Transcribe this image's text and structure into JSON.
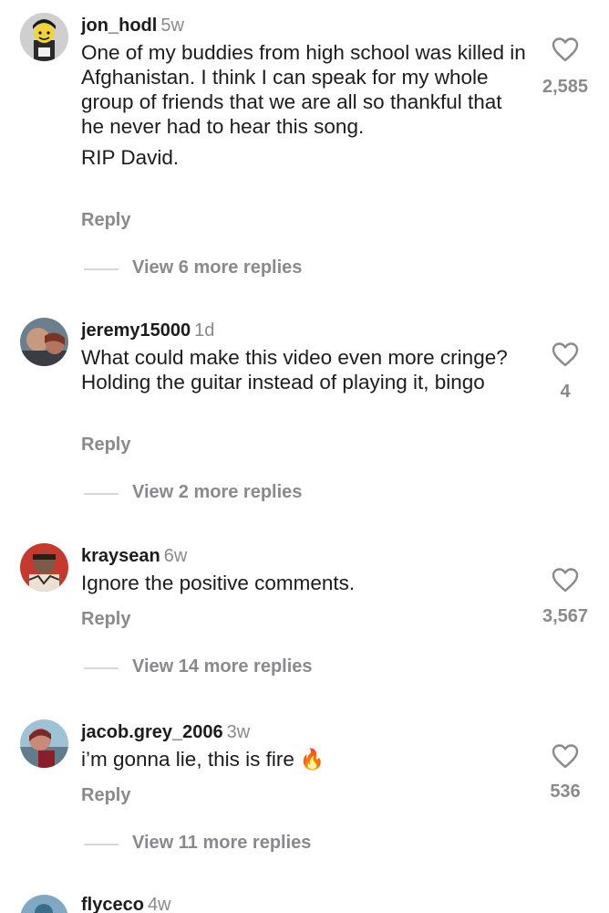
{
  "comments": [
    {
      "username": "jon_hodl",
      "time": "5w",
      "lines": [
        "One of my buddies from high school was killed in Afghanistan. I think I can speak for my whole group of friends that we are all so thankful that he never had to hear this song.",
        "RIP David."
      ],
      "reply_label": "Reply",
      "likes": "2,585",
      "view_more": "View 6 more replies"
    },
    {
      "username": "jeremy15000",
      "time": "1d",
      "lines": [
        "What could make this video even more cringe? Holding the guitar instead of playing it, bingo"
      ],
      "reply_label": "Reply",
      "likes": "4",
      "view_more": "View 2 more replies"
    },
    {
      "username": "kraysean",
      "time": "6w",
      "lines": [
        "Ignore the positive comments."
      ],
      "reply_label": "Reply",
      "likes": "3,567",
      "view_more": "View 14 more replies"
    },
    {
      "username": "jacob.grey_2006",
      "time": "3w",
      "lines": [
        "i’m gonna lie, this is fire"
      ],
      "emoji": "🔥",
      "reply_label": "Reply",
      "likes": "536",
      "view_more": "View 11 more replies"
    },
    {
      "username": "flyceco",
      "time": "4w"
    }
  ],
  "icons": {
    "like": "heart-outline-icon"
  },
  "colors": {
    "text": "#1c1c1e",
    "muted": "#8a8a8e",
    "divider": "#d8d8dc"
  }
}
